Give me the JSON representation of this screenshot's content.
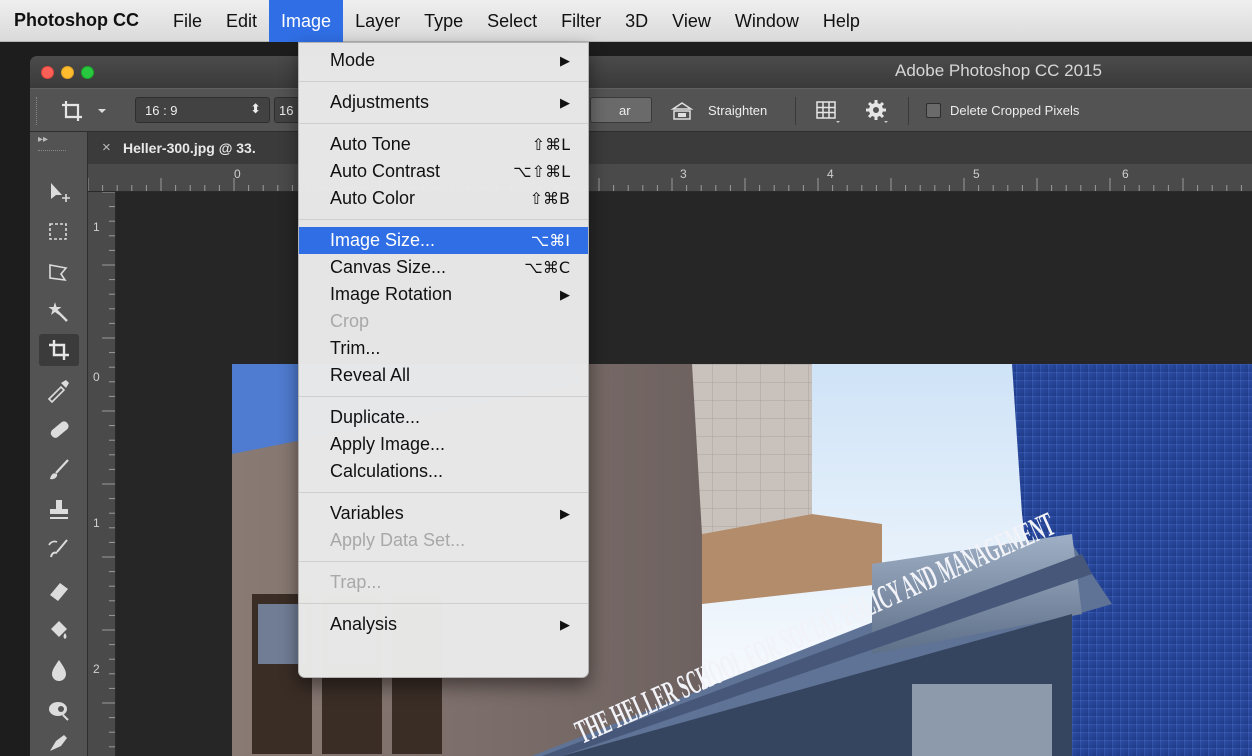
{
  "menubar": {
    "app_name": "Photoshop CC",
    "items": [
      "File",
      "Edit",
      "Image",
      "Layer",
      "Type",
      "Select",
      "Filter",
      "3D",
      "View",
      "Window",
      "Help"
    ],
    "active_item": "Image"
  },
  "window": {
    "title": "Adobe Photoshop CC 2015",
    "traffic_lights": {
      "close": "#fe5f57",
      "minimize": "#febc2e",
      "zoom": "#28c840"
    }
  },
  "options_bar": {
    "ratio_value": "16 : 9",
    "width_value_partial": "16",
    "clear_partial": "ar",
    "straighten_label": "Straighten",
    "delete_cropped_label": "Delete Cropped Pixels",
    "delete_cropped_checked": false
  },
  "document": {
    "tab_title": "Heller-300.jpg @ 33.",
    "close_glyph": "×"
  },
  "rulers": {
    "horizontal": [
      "0",
      "3",
      "4",
      "5",
      "6"
    ],
    "vertical": [
      "1",
      "0",
      "1",
      "2"
    ]
  },
  "image_menu": {
    "sections": [
      [
        {
          "label": "Mode",
          "submenu": true
        }
      ],
      [
        {
          "label": "Adjustments",
          "submenu": true
        }
      ],
      [
        {
          "label": "Auto Tone",
          "shortcut": "⇧⌘L"
        },
        {
          "label": "Auto Contrast",
          "shortcut": "⌥⇧⌘L"
        },
        {
          "label": "Auto Color",
          "shortcut": "⇧⌘B"
        }
      ],
      [
        {
          "label": "Image Size...",
          "shortcut": "⌥⌘I",
          "highlighted": true
        },
        {
          "label": "Canvas Size...",
          "shortcut": "⌥⌘C"
        },
        {
          "label": "Image Rotation",
          "submenu": true
        },
        {
          "label": "Crop",
          "disabled": true
        },
        {
          "label": "Trim..."
        },
        {
          "label": "Reveal All"
        }
      ],
      [
        {
          "label": "Duplicate..."
        },
        {
          "label": "Apply Image..."
        },
        {
          "label": "Calculations..."
        }
      ],
      [
        {
          "label": "Variables",
          "submenu": true
        },
        {
          "label": "Apply Data Set...",
          "disabled": true
        }
      ],
      [
        {
          "label": "Trap...",
          "disabled": true
        }
      ],
      [
        {
          "label": "Analysis",
          "submenu": true
        }
      ]
    ],
    "submenu_arrow": "▶",
    "highlight_color": "#2f6ee4"
  },
  "photo": {
    "sign_text": "THE HELLER SCHOOL FOR SOCIAL POLICY AND MANAGEMENT"
  }
}
